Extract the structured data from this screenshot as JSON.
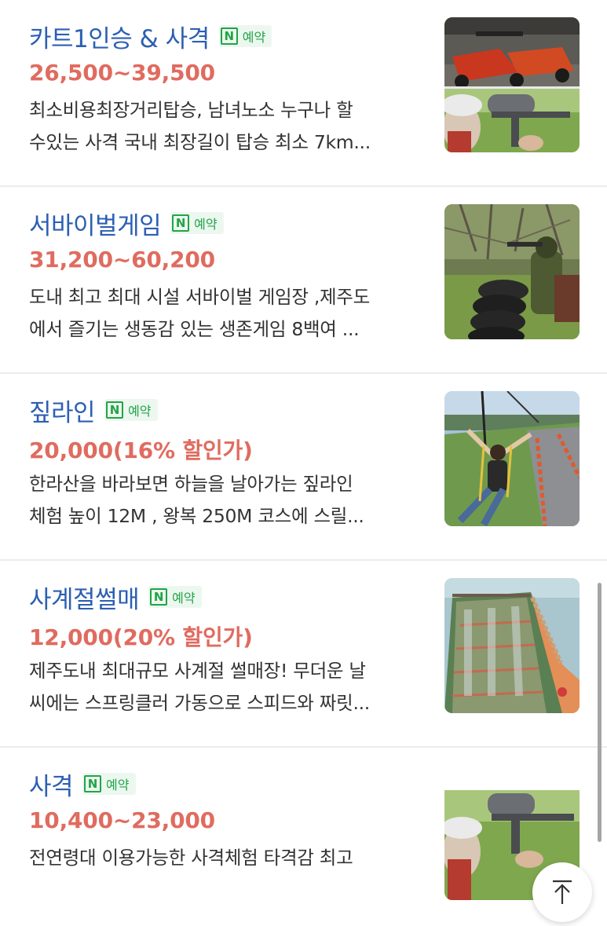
{
  "badge_label": "예약",
  "badge_icon": "naver-n-icon",
  "colors": {
    "title": "#2c5fb3",
    "price": "#e06b5f",
    "badge": "#22a447"
  },
  "items": [
    {
      "title": "카트1인승 & 사격",
      "price": "26,500~39,500",
      "desc_line1": "최소비용최장거리탑승, 남녀노소 누구나 할",
      "desc_line2": "수있는 사격 국내 최장길이 탑승 최소 7km..."
    },
    {
      "title": "서바이벌게임",
      "price": "31,200~60,200",
      "desc_line1": "도내 최고 최대 시설 서바이벌 게임장 ,제주도",
      "desc_line2": "에서 즐기는 생동감 있는 생존게임 8백여 ..."
    },
    {
      "title": "짚라인",
      "price": "20,000(16% 할인가)",
      "desc_line1": "한라산을 바라보면 하늘을 날아가는 짚라인",
      "desc_line2": "체험 높이 12M , 왕복 250M 코스에 스릴..."
    },
    {
      "title": "사계절썰매",
      "price": "12,000(20% 할인가)",
      "desc_line1": "제주도내 최대규모 사계절 썰매장! 무더운 날",
      "desc_line2": "씨에는 스프링클러 가동으로 스피드와 짜릿..."
    },
    {
      "title": "사격",
      "price": "10,400~23,000",
      "desc_line1": "전연령대 이용가능한 사격체험 타격감 최고",
      "desc_line2": ""
    }
  ],
  "scroll_top_icon": "arrow-up-icon"
}
